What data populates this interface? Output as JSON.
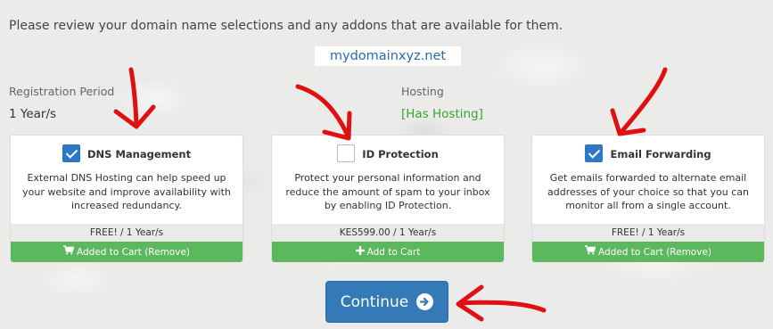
{
  "intro": "Please review your domain name selections and any addons that are available for them.",
  "domain": "mydomainxyz.net",
  "registration": {
    "label": "Registration Period",
    "value": "1 Year/s"
  },
  "hosting": {
    "label": "Hosting",
    "value": "[Has Hosting]"
  },
  "addons": [
    {
      "title": "DNS Management",
      "checked": true,
      "description": "External DNS Hosting can help speed up your website and improve availability with increased redundancy.",
      "price": "FREE! / 1 Year/s",
      "action": "Added to Cart (Remove)",
      "action_icon": "cart-icon"
    },
    {
      "title": "ID Protection",
      "checked": false,
      "description": "Protect your personal information and reduce the amount of spam to your inbox by enabling ID Protection.",
      "price": "KES599.00 / 1 Year/s",
      "action": "Add to Cart",
      "action_icon": "plus-icon"
    },
    {
      "title": "Email Forwarding",
      "checked": true,
      "description": "Get emails forwarded to alternate email addresses of your choice so that you can monitor all from a single account.",
      "price": "FREE! / 1 Year/s",
      "action": "Added to Cart (Remove)",
      "action_icon": "cart-icon"
    }
  ],
  "continue_button": {
    "label": "Continue",
    "icon": "arrow-circle-right-icon"
  },
  "colors": {
    "primary": "#337ab7",
    "success": "#5cb85c",
    "hosting_text": "#3aa335",
    "annotation_red": "#e01010"
  }
}
